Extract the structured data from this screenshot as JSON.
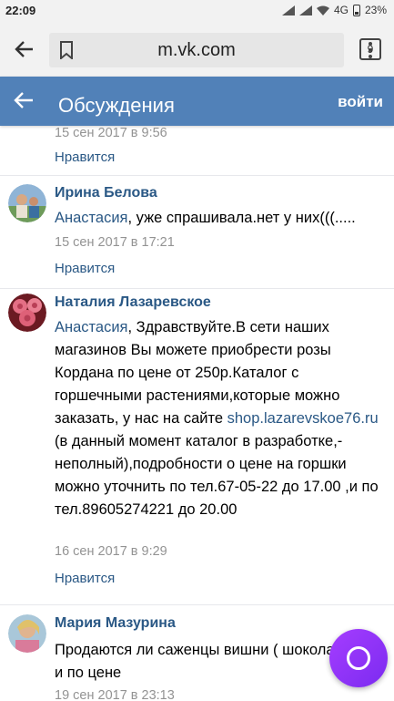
{
  "status_bar": {
    "time": "22:09",
    "network": "4G",
    "battery": "23%"
  },
  "browser": {
    "url": "m.vk.com",
    "tabs_count": "9"
  },
  "header": {
    "title": "Обсуждения",
    "login": "войти"
  },
  "top_fragment": {
    "date": "15 сен 2017 в 9:56",
    "like": "Нравится"
  },
  "comments": [
    {
      "author": "Ирина Белова",
      "mention": "Анастасия",
      "text": ", уже спрашивала.нет у них(((.....",
      "date": "15 сен 2017 в 17:21",
      "like": "Нравится"
    },
    {
      "author": "Наталия Лазаревское",
      "mention": "Анастасия",
      "text_before_link": ", Здравствуйте.В сети наших магазинов Вы можете приобрести розы Кордана по цене от 250р.Каталог с горшечными растениями,которые можно заказать, у нас на сайте ",
      "link": "shop.lazarevskoe76.ru",
      "text_after_link": " (в данный момент каталог в разработке,-неполный),подробности о цене на горшки можно уточнить по тел.67-05-22 до 17.00 ,и по тел.89605274221 до 20.00",
      "date": "16 сен 2017 в 9:29",
      "like": "Нравится"
    },
    {
      "author": "Мария Мазурина",
      "text": "Продаются ли саженцы вишни ( шоколадница) и по цене",
      "date": "19 сен 2017 в 23:13"
    }
  ],
  "colors": {
    "vk_header": "#5181b8",
    "link": "#2a5885",
    "date": "#939393",
    "alice": "#8a33f5"
  }
}
